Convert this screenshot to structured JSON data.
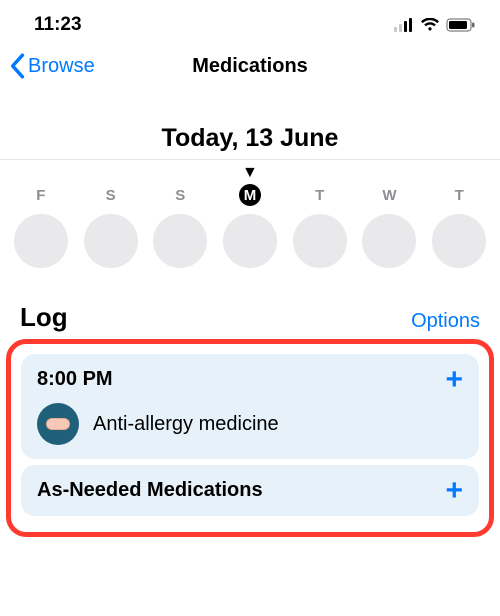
{
  "status": {
    "time": "11:23"
  },
  "nav": {
    "back_label": "Browse",
    "title": "Medications"
  },
  "date_heading": "Today, 13 June",
  "week": {
    "days": [
      "F",
      "S",
      "S",
      "M",
      "T",
      "W",
      "T"
    ],
    "selected_index": 3
  },
  "log": {
    "title": "Log",
    "options_label": "Options",
    "scheduled": {
      "time": "8:00 PM",
      "medications": [
        {
          "name": "Anti-allergy medicine",
          "icon": "pill-icon"
        }
      ]
    },
    "as_needed_label": "As-Needed Medications"
  }
}
